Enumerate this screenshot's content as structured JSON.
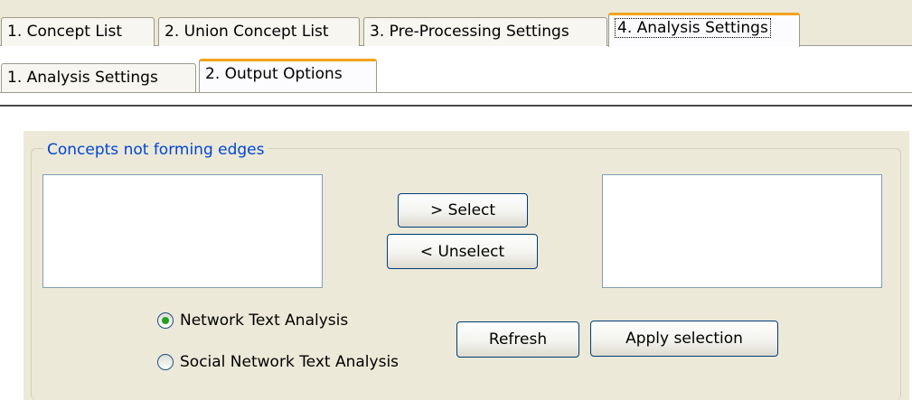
{
  "top_tabs": [
    {
      "label": "1. Concept List"
    },
    {
      "label": "2. Union Concept List"
    },
    {
      "label": "3. Pre-Processing Settings"
    },
    {
      "label": "4. Analysis Settings",
      "selected": true
    }
  ],
  "sub_tabs": [
    {
      "label": "1. Analysis Settings"
    },
    {
      "label": "2. Output Options",
      "selected": true
    }
  ],
  "group": {
    "title": "Concepts not forming edges",
    "select_button": "> Select",
    "unselect_button": "< Unselect",
    "refresh_button": "Refresh",
    "apply_button": "Apply selection",
    "radio_options": [
      {
        "label": "Network Text Analysis",
        "checked": true
      },
      {
        "label": "Social Network Text Analysis",
        "checked": false
      }
    ]
  },
  "colors": {
    "accent_tab": "#f2a31b",
    "legend_text": "#0046d5",
    "panel_bg": "#ece9d8",
    "radio_dot": "#21a121"
  }
}
